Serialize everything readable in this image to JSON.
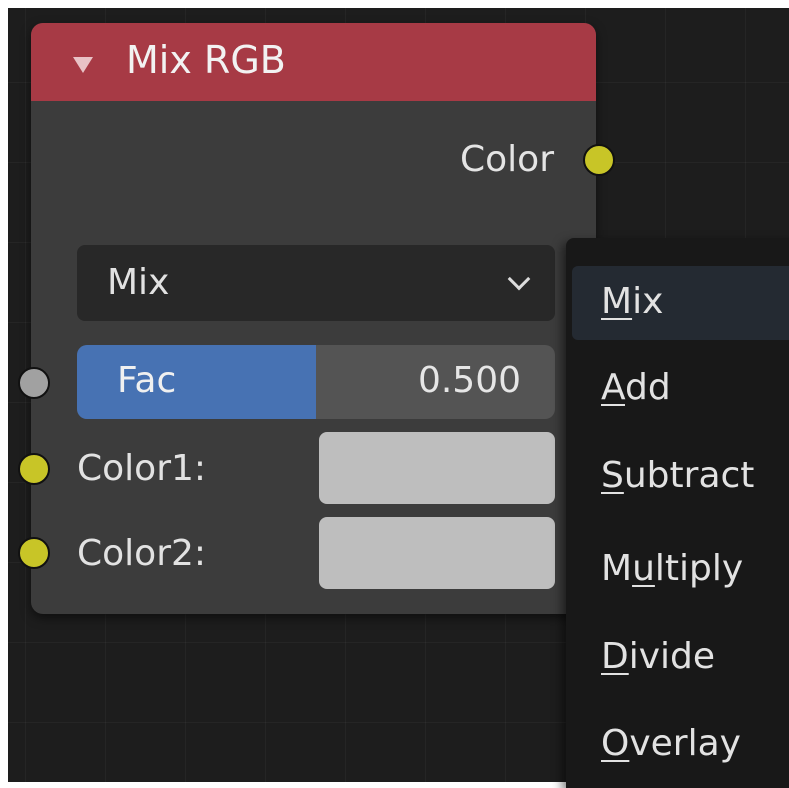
{
  "node": {
    "title": "Mix RGB",
    "header_color": "#a73a45",
    "output": {
      "label": "Color",
      "socket_color": "#c8c527"
    },
    "blend_mode": {
      "value": "Mix"
    },
    "fac": {
      "label": "Fac",
      "value": "0.500",
      "fill_fraction": 0.5
    },
    "inputs": [
      {
        "label": "Color1:",
        "swatch_color": "#bebebe",
        "socket_color": "#c8c527"
      },
      {
        "label": "Color2:",
        "swatch_color": "#bebebe",
        "socket_color": "#c8c527"
      }
    ]
  },
  "blend_menu": {
    "items": [
      {
        "label": "Mix",
        "mnemonic": "M",
        "highlighted": true
      },
      {
        "label": "Add",
        "mnemonic": "A",
        "highlighted": false
      },
      {
        "label": "Subtract",
        "mnemonic": "S",
        "highlighted": false
      },
      {
        "label": "Multiply",
        "mnemonic": "u",
        "highlighted": false
      },
      {
        "label": "Divide",
        "mnemonic": "D",
        "highlighted": false
      },
      {
        "label": "Overlay",
        "mnemonic": "O",
        "highlighted": false
      }
    ]
  },
  "colors": {
    "accent": "#4772b3",
    "socket_value": "#a1a1a1",
    "canvas": "#1d1d1d"
  }
}
